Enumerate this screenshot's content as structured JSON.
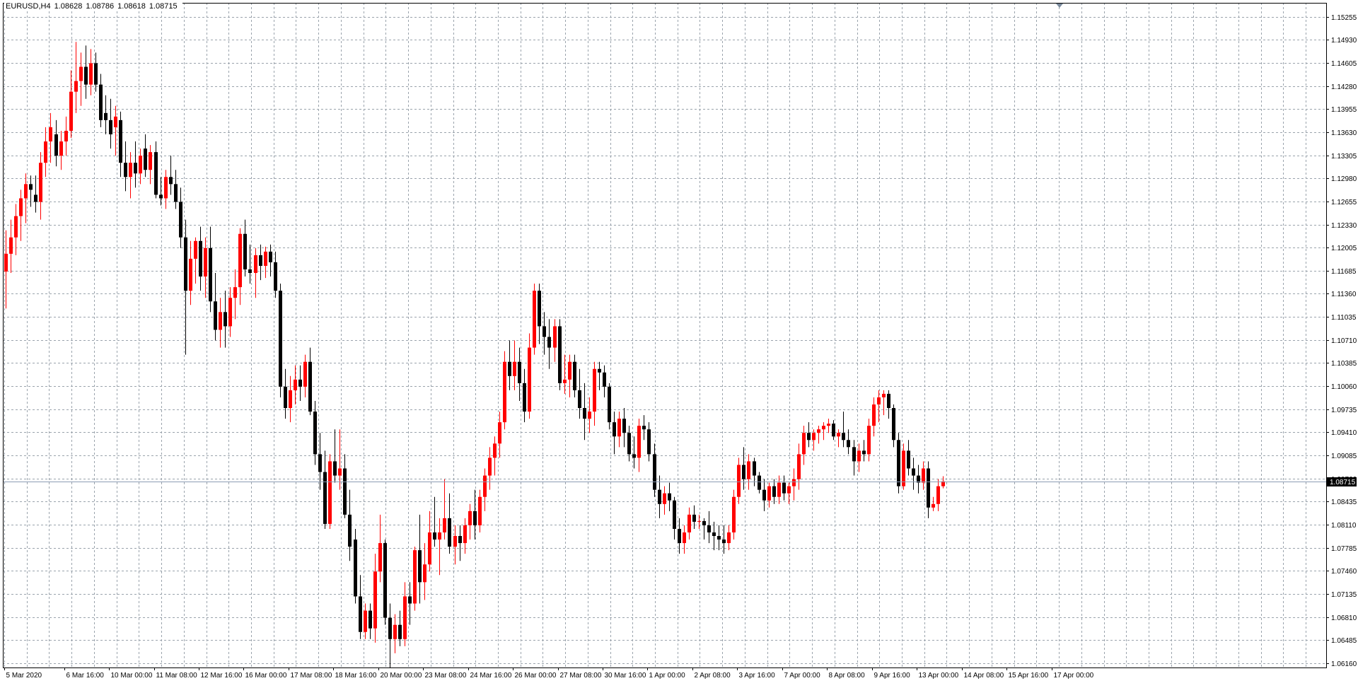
{
  "header": {
    "symbol": "EURUSD,H4",
    "open": "1.08628",
    "high": "1.08786",
    "low": "1.08618",
    "close": "1.08715"
  },
  "current_price_label": "1.08715",
  "colors": {
    "background": "#ffffff",
    "grid": "#9aa3ac",
    "bull_candle": "#ff0000",
    "bear_candle": "#000000",
    "neutral_candle": "#00c000",
    "price_line": "#8c9cb4",
    "axis": "#000000"
  },
  "chart_data": {
    "type": "candlestick",
    "title": "",
    "timeframe": "H4",
    "grid": true,
    "ylim": [
      1.061,
      1.1545
    ],
    "y_ticks": [
      "1.15255",
      "1.14930",
      "1.14605",
      "1.14280",
      "1.13955",
      "1.13630",
      "1.13305",
      "1.12980",
      "1.12655",
      "1.12330",
      "1.12005",
      "1.11685",
      "1.11360",
      "1.11035",
      "1.10710",
      "1.10385",
      "1.10060",
      "1.09735",
      "1.09410",
      "1.09085",
      "1.08760",
      "1.08435",
      "1.08110",
      "1.07785",
      "1.07460",
      "1.07135",
      "1.06810",
      "1.06485",
      "1.06160"
    ],
    "x_ticks": [
      {
        "bar": 0,
        "label": "5 Mar 2020"
      },
      {
        "bar": 12,
        "label": "6 Mar 16:00"
      },
      {
        "bar": 21,
        "label": "10 Mar 00:00"
      },
      {
        "bar": 30,
        "label": "11 Mar 08:00"
      },
      {
        "bar": 39,
        "label": "12 Mar 16:00"
      },
      {
        "bar": 48,
        "label": "16 Mar 00:00"
      },
      {
        "bar": 57,
        "label": "17 Mar 08:00"
      },
      {
        "bar": 66,
        "label": "18 Mar 16:00"
      },
      {
        "bar": 75,
        "label": "20 Mar 00:00"
      },
      {
        "bar": 84,
        "label": "23 Mar 08:00"
      },
      {
        "bar": 93,
        "label": "24 Mar 16:00"
      },
      {
        "bar": 102,
        "label": "26 Mar 00:00"
      },
      {
        "bar": 111,
        "label": "27 Mar 08:00"
      },
      {
        "bar": 120,
        "label": "30 Mar 16:00"
      },
      {
        "bar": 129,
        "label": "1 Apr 00:00"
      },
      {
        "bar": 138,
        "label": "2 Apr 08:00"
      },
      {
        "bar": 147,
        "label": "3 Apr 16:00"
      },
      {
        "bar": 156,
        "label": "7 Apr 00:00"
      },
      {
        "bar": 165,
        "label": "8 Apr 08:00"
      },
      {
        "bar": 174,
        "label": "9 Apr 16:00"
      },
      {
        "bar": 183,
        "label": "13 Apr 00:00"
      },
      {
        "bar": 192,
        "label": "14 Apr 08:00"
      },
      {
        "bar": 201,
        "label": "15 Apr 16:00"
      },
      {
        "bar": 210,
        "label": "17 Apr 00:00"
      }
    ],
    "current_price": 1.08715,
    "candles": [
      [
        1.1167,
        1.1225,
        1.1115,
        1.1192
      ],
      [
        1.1192,
        1.124,
        1.1165,
        1.1215
      ],
      [
        1.1215,
        1.1262,
        1.119,
        1.1245
      ],
      [
        1.1245,
        1.1282,
        1.121,
        1.127
      ],
      [
        1.127,
        1.1305,
        1.1235,
        1.129
      ],
      [
        1.129,
        1.1302,
        1.1258,
        1.1282
      ],
      [
        1.1275,
        1.1302,
        1.125,
        1.1265
      ],
      [
        1.1265,
        1.1335,
        1.124,
        1.132
      ],
      [
        1.132,
        1.137,
        1.13,
        1.135
      ],
      [
        1.135,
        1.139,
        1.132,
        1.137
      ],
      [
        1.136,
        1.138,
        1.1315,
        1.133
      ],
      [
        1.133,
        1.1365,
        1.131,
        1.135
      ],
      [
        1.135,
        1.1385,
        1.133,
        1.1365
      ],
      [
        1.1365,
        1.145,
        1.1355,
        1.142
      ],
      [
        1.142,
        1.149,
        1.139,
        1.1435
      ],
      [
        1.1435,
        1.1475,
        1.14,
        1.1455
      ],
      [
        1.1455,
        1.1485,
        1.141,
        1.143
      ],
      [
        1.143,
        1.148,
        1.1415,
        1.146
      ],
      [
        1.146,
        1.1475,
        1.142,
        1.143
      ],
      [
        1.143,
        1.1445,
        1.137,
        1.138
      ],
      [
        1.139,
        1.1415,
        1.136,
        1.138
      ],
      [
        1.138,
        1.141,
        1.134,
        1.136
      ],
      [
        1.137,
        1.14,
        1.133,
        1.1385
      ],
      [
        1.138,
        1.1392,
        1.13,
        1.132
      ],
      [
        1.132,
        1.135,
        1.128,
        1.13
      ],
      [
        1.13,
        1.1335,
        1.127,
        1.132
      ],
      [
        1.132,
        1.135,
        1.1285,
        1.1305
      ],
      [
        1.1305,
        1.134,
        1.129,
        1.133
      ],
      [
        1.134,
        1.136,
        1.13,
        1.131
      ],
      [
        1.131,
        1.1345,
        1.129,
        1.1335
      ],
      [
        1.1335,
        1.135,
        1.127,
        1.1275
      ],
      [
        1.1275,
        1.13,
        1.126,
        1.127
      ],
      [
        1.127,
        1.131,
        1.1255,
        1.13
      ],
      [
        1.13,
        1.133,
        1.1275,
        1.129
      ],
      [
        1.129,
        1.131,
        1.1255,
        1.1265
      ],
      [
        1.1265,
        1.1285,
        1.12,
        1.1215
      ],
      [
        1.1215,
        1.124,
        1.105,
        1.114
      ],
      [
        1.114,
        1.121,
        1.112,
        1.1185
      ],
      [
        1.1185,
        1.1215,
        1.115,
        1.121
      ],
      [
        1.121,
        1.123,
        1.114,
        1.116
      ],
      [
        1.116,
        1.1215,
        1.113,
        1.12
      ],
      [
        1.12,
        1.123,
        1.111,
        1.1125
      ],
      [
        1.1125,
        1.1165,
        1.107,
        1.1085
      ],
      [
        1.1085,
        1.113,
        1.106,
        1.111
      ],
      [
        1.111,
        1.114,
        1.106,
        1.109
      ],
      [
        1.109,
        1.1145,
        1.1075,
        1.113
      ],
      [
        1.113,
        1.117,
        1.11,
        1.1145
      ],
      [
        1.1145,
        1.1228,
        1.112,
        1.122
      ],
      [
        1.122,
        1.124,
        1.116,
        1.117
      ],
      [
        1.117,
        1.1205,
        1.115,
        1.1165
      ],
      [
        1.1165,
        1.12,
        1.113,
        1.119
      ],
      [
        1.119,
        1.1205,
        1.1155,
        1.1175
      ],
      [
        1.1175,
        1.1202,
        1.1158,
        1.1195
      ],
      [
        1.1195,
        1.1205,
        1.116,
        1.118
      ],
      [
        1.118,
        1.1195,
        1.113,
        1.114
      ],
      [
        1.114,
        1.115,
        1.099,
        1.1005
      ],
      [
        1.1005,
        1.103,
        1.096,
        1.0975
      ],
      [
        1.0975,
        1.102,
        1.0955,
        1.1
      ],
      [
        1.1,
        1.1035,
        1.098,
        1.1015
      ],
      [
        1.1015,
        1.1035,
        1.0985,
        1.1005
      ],
      [
        1.1005,
        1.105,
        1.099,
        1.104
      ],
      [
        1.104,
        1.106,
        1.0965,
        1.097
      ],
      [
        1.097,
        1.0985,
        1.0895,
        1.091
      ],
      [
        1.091,
        1.094,
        1.086,
        1.0885
      ],
      [
        1.0885,
        1.0915,
        1.0805,
        1.0812
      ],
      [
        1.0812,
        1.091,
        1.0805,
        1.09
      ],
      [
        1.09,
        1.0945,
        1.087,
        1.088
      ],
      [
        1.088,
        1.0945,
        1.086,
        1.089
      ],
      [
        1.089,
        1.091,
        1.082,
        1.0825
      ],
      [
        1.0825,
        1.086,
        1.076,
        1.078
      ],
      [
        1.079,
        1.0805,
        1.07,
        1.071
      ],
      [
        1.071,
        1.074,
        1.065,
        1.066
      ],
      [
        1.066,
        1.07,
        1.065,
        1.069
      ],
      [
        1.069,
        1.07,
        1.065,
        1.0665
      ],
      [
        1.0665,
        1.077,
        1.0645,
        1.0745
      ],
      [
        1.0745,
        1.0825,
        1.073,
        1.0785
      ],
      [
        1.0785,
        1.079,
        1.067,
        1.068
      ],
      [
        1.068,
        1.07,
        1.061,
        1.065
      ],
      [
        1.065,
        1.0685,
        1.063,
        1.067
      ],
      [
        1.067,
        1.069,
        1.064,
        1.065
      ],
      [
        1.065,
        1.073,
        1.064,
        1.071
      ],
      [
        1.071,
        1.073,
        1.067,
        1.07
      ],
      [
        1.07,
        1.078,
        1.069,
        1.0775
      ],
      [
        1.0775,
        1.0825,
        1.07,
        1.073
      ],
      [
        1.073,
        1.0785,
        1.0705,
        1.0755
      ],
      [
        1.0755,
        1.083,
        1.0745,
        1.08
      ],
      [
        1.08,
        1.085,
        1.078,
        1.079
      ],
      [
        1.079,
        1.082,
        1.074,
        1.08
      ],
      [
        1.08,
        1.0875,
        1.079,
        1.082
      ],
      [
        1.082,
        1.0855,
        1.077,
        1.078
      ],
      [
        1.078,
        1.081,
        1.0755,
        1.0795
      ],
      [
        1.0795,
        1.081,
        1.076,
        1.0785
      ],
      [
        1.0785,
        1.082,
        1.077,
        1.081
      ],
      [
        1.081,
        1.084,
        1.079,
        1.083
      ],
      [
        1.083,
        1.086,
        1.079,
        1.081
      ],
      [
        1.081,
        1.086,
        1.08,
        1.085
      ],
      [
        1.085,
        1.089,
        1.083,
        1.088
      ],
      [
        1.088,
        1.092,
        1.086,
        1.0905
      ],
      [
        1.0905,
        1.0935,
        1.088,
        1.0925
      ],
      [
        1.0925,
        1.097,
        1.0905,
        1.0955
      ],
      [
        1.0955,
        1.1055,
        1.0945,
        1.104
      ],
      [
        1.104,
        1.107,
        1.1,
        1.102
      ],
      [
        1.102,
        1.107,
        1.1,
        1.104
      ],
      [
        1.104,
        1.106,
        1.0985,
        1.101
      ],
      [
        1.101,
        1.103,
        1.0955,
        1.097
      ],
      [
        1.097,
        1.108,
        1.096,
        1.106
      ],
      [
        1.106,
        1.115,
        1.105,
        1.114
      ],
      [
        1.114,
        1.115,
        1.1065,
        1.109
      ],
      [
        1.109,
        1.111,
        1.105,
        1.1075
      ],
      [
        1.1075,
        1.11,
        1.103,
        1.106
      ],
      [
        1.106,
        1.11,
        1.104,
        1.109
      ],
      [
        1.109,
        1.11,
        1.1,
        1.101
      ],
      [
        1.101,
        1.105,
        1.0995,
        1.1015
      ],
      [
        1.1015,
        1.105,
        1.099,
        1.104
      ],
      [
        1.104,
        1.105,
        1.099,
        1.1
      ],
      [
        1.1,
        1.103,
        1.096,
        1.0975
      ],
      [
        1.0975,
        1.101,
        1.093,
        1.096
      ],
      [
        1.096,
        1.099,
        1.094,
        1.097
      ],
      [
        1.097,
        1.104,
        1.095,
        1.103
      ],
      [
        1.103,
        1.104,
        1.1,
        1.1025
      ],
      [
        1.1025,
        1.1035,
        1.099,
        1.1005
      ],
      [
        1.1005,
        1.101,
        1.0945,
        1.0955
      ],
      [
        1.0955,
        1.097,
        1.091,
        1.0935
      ],
      [
        1.0935,
        1.097,
        1.092,
        1.096
      ],
      [
        1.096,
        1.0975,
        1.092,
        1.094
      ],
      [
        1.094,
        1.095,
        1.09,
        1.091
      ],
      [
        1.091,
        1.0935,
        1.089,
        1.0905
      ],
      [
        1.0905,
        1.096,
        1.0885,
        1.095
      ],
      [
        1.095,
        1.0965,
        1.093,
        1.0945
      ],
      [
        1.0945,
        1.0955,
        1.09,
        1.091
      ],
      [
        1.091,
        1.0925,
        1.085,
        1.086
      ],
      [
        1.086,
        1.088,
        1.082,
        1.084
      ],
      [
        1.084,
        1.0865,
        1.0825,
        1.0855
      ],
      [
        1.0855,
        1.087,
        1.083,
        1.0845
      ],
      [
        1.0845,
        1.085,
        1.079,
        1.0805
      ],
      [
        1.0805,
        1.082,
        1.077,
        1.0785
      ],
      [
        1.0785,
        1.081,
        1.077,
        1.08
      ],
      [
        1.08,
        1.0835,
        1.079,
        1.0825
      ],
      [
        1.0825,
        1.0838,
        1.0805,
        1.0815
      ],
      [
        1.0815,
        1.0825,
        1.0805,
        1.0816
      ],
      [
        1.0816,
        1.082,
        1.079,
        1.081
      ],
      [
        1.081,
        1.083,
        1.0785,
        1.08
      ],
      [
        1.08,
        1.0815,
        1.0775,
        1.0795
      ],
      [
        1.0795,
        1.081,
        1.0775,
        1.079
      ],
      [
        1.079,
        1.081,
        1.077,
        1.0785
      ],
      [
        1.0785,
        1.081,
        1.0775,
        1.08
      ],
      [
        1.08,
        1.086,
        1.079,
        1.085
      ],
      [
        1.085,
        1.0905,
        1.084,
        1.0895
      ],
      [
        1.0895,
        1.092,
        1.086,
        1.0875
      ],
      [
        1.0875,
        1.091,
        1.086,
        1.09
      ],
      [
        1.09,
        1.0905,
        1.0865,
        1.088
      ],
      [
        1.088,
        1.0885,
        1.0855,
        1.086
      ],
      [
        1.086,
        1.0875,
        1.083,
        1.0845
      ],
      [
        1.0845,
        1.087,
        1.0835,
        1.0865
      ],
      [
        1.0865,
        1.0875,
        1.084,
        1.085
      ],
      [
        1.085,
        1.088,
        1.084,
        1.087
      ],
      [
        1.087,
        1.088,
        1.0845,
        1.0855
      ],
      [
        1.0855,
        1.087,
        1.084,
        1.0865
      ],
      [
        1.0865,
        1.089,
        1.0845,
        1.0875
      ],
      [
        1.0875,
        1.0925,
        1.086,
        1.091
      ],
      [
        1.091,
        1.095,
        1.0895,
        1.094
      ],
      [
        1.094,
        1.0955,
        1.092,
        1.093
      ],
      [
        1.093,
        1.0945,
        1.0915,
        1.094
      ],
      [
        1.094,
        1.095,
        1.0925,
        1.0945
      ],
      [
        1.0945,
        1.0955,
        1.093,
        1.095
      ],
      [
        1.095,
        1.096,
        1.094,
        1.0953
      ],
      [
        1.0953,
        1.0958,
        1.093,
        1.0935
      ],
      [
        1.0935,
        1.0945,
        1.092,
        1.094
      ],
      [
        1.094,
        1.097,
        1.092,
        1.093
      ],
      [
        1.093,
        1.0945,
        1.091,
        1.092
      ],
      [
        1.092,
        1.093,
        1.088,
        1.09
      ],
      [
        1.09,
        1.0925,
        1.0885,
        1.0915
      ],
      [
        1.0915,
        1.093,
        1.09,
        1.091
      ],
      [
        1.091,
        1.096,
        1.09,
        1.095
      ],
      [
        1.095,
        1.099,
        1.0935,
        1.098
      ],
      [
        1.098,
        1.1,
        1.0955,
        1.099
      ],
      [
        1.099,
        1.1,
        1.0965,
        1.0995
      ],
      [
        1.0995,
        1.1,
        1.096,
        1.0975
      ],
      [
        1.0975,
        1.098,
        1.092,
        1.093
      ],
      [
        1.093,
        1.094,
        1.0855,
        1.0865
      ],
      [
        1.0865,
        1.0925,
        1.086,
        1.0915
      ],
      [
        1.0915,
        1.093,
        1.088,
        1.089
      ],
      [
        1.089,
        1.0905,
        1.086,
        1.088
      ],
      [
        1.088,
        1.0895,
        1.0855,
        1.087
      ],
      [
        1.087,
        1.09,
        1.086,
        1.089
      ],
      [
        1.089,
        1.09,
        1.082,
        1.0835
      ],
      [
        1.0835,
        1.085,
        1.083,
        1.084
      ],
      [
        1.084,
        1.0875,
        1.083,
        1.0865
      ],
      [
        1.0865,
        1.0879,
        1.0862,
        1.0872
      ]
    ]
  }
}
